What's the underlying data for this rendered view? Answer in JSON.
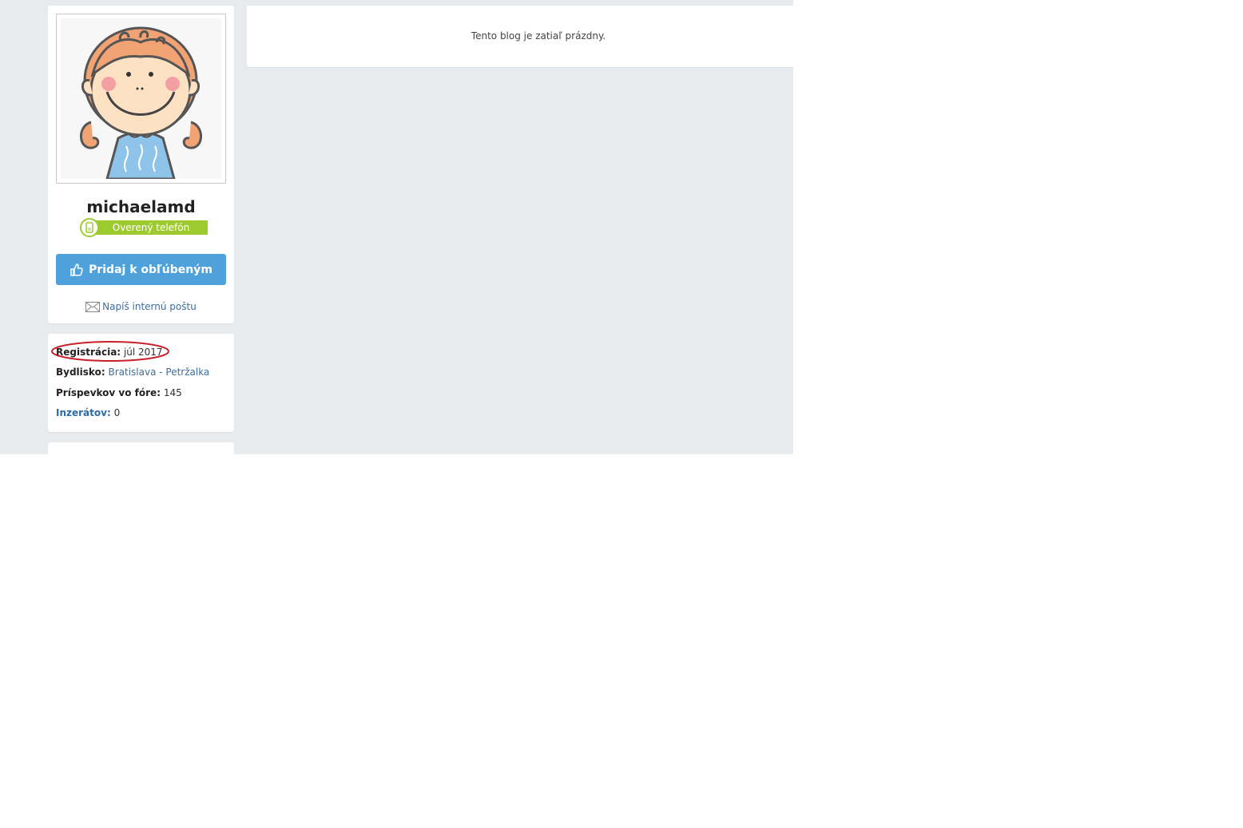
{
  "profile": {
    "username": "michaelamd",
    "verified_badge": "Overený telefón",
    "verified_icon": "phone-icon",
    "favorite_button": "Pridaj k obľúbeným",
    "favorite_icon": "thumbs-up-icon",
    "mail_link": "Napíš internú poštu",
    "mail_icon": "envelope-icon"
  },
  "info": {
    "registration_label": "Registrácia:",
    "registration_value": "júl 2017",
    "residence_label": "Bydlisko:",
    "residence_value": "Bratislava - Petržalka",
    "posts_label": "Príspevkov vo fóre:",
    "posts_value": "145",
    "ads_label": "Inzerátov:",
    "ads_value": "0"
  },
  "blog": {
    "empty_message": "Tento blog je zatiaľ prázdny."
  },
  "colors": {
    "page_bg": "#e8ebee",
    "button_blue": "#4fa1db",
    "badge_green": "#9dcb2f",
    "link_blue": "#3d6d9b",
    "annotation_red": "#c8202a"
  }
}
